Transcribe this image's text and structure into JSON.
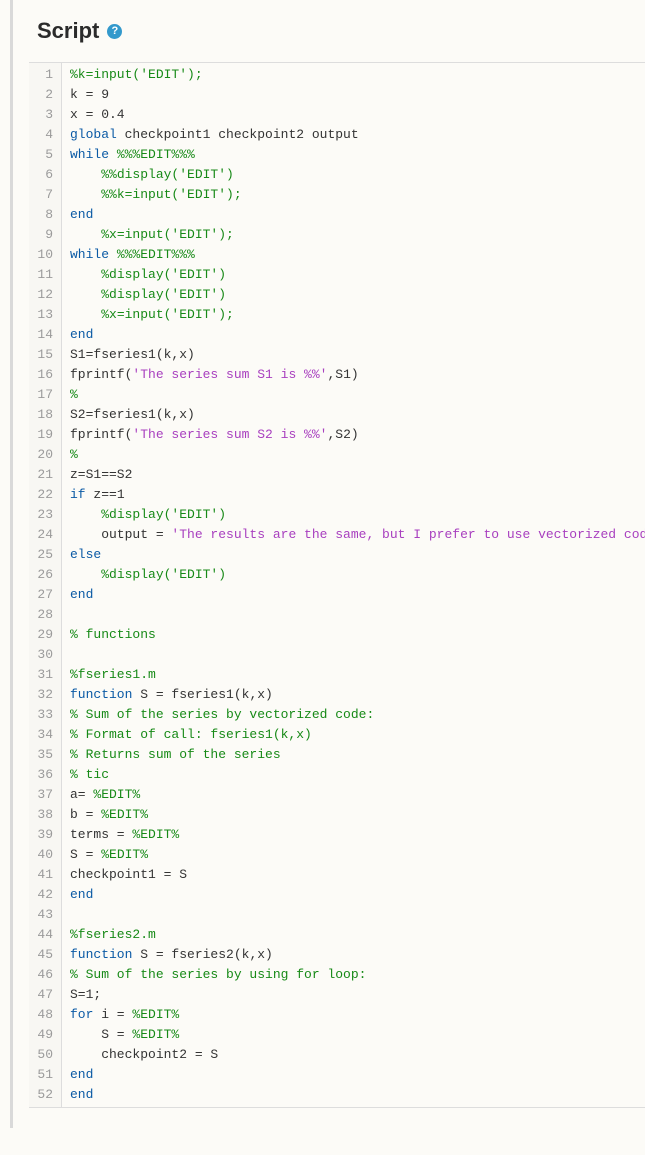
{
  "header": {
    "title": "Script",
    "help_symbol": "?"
  },
  "code_lines": [
    [
      {
        "cls": "c-comment",
        "text": "%k=input('EDIT');"
      }
    ],
    [
      {
        "cls": "c-plain",
        "text": "k = 9"
      }
    ],
    [
      {
        "cls": "c-plain",
        "text": "x = 0.4"
      }
    ],
    [
      {
        "cls": "c-keyword",
        "text": "global"
      },
      {
        "cls": "c-plain",
        "text": " checkpoint1 checkpoint2 output"
      }
    ],
    [
      {
        "cls": "c-keyword",
        "text": "while"
      },
      {
        "cls": "c-plain",
        "text": " "
      },
      {
        "cls": "c-comment",
        "text": "%%%EDIT%%%"
      }
    ],
    [
      {
        "cls": "c-plain",
        "text": "    "
      },
      {
        "cls": "c-comment",
        "text": "%%display('EDIT')"
      }
    ],
    [
      {
        "cls": "c-plain",
        "text": "    "
      },
      {
        "cls": "c-comment",
        "text": "%%k=input('EDIT');"
      }
    ],
    [
      {
        "cls": "c-keyword",
        "text": "end"
      }
    ],
    [
      {
        "cls": "c-plain",
        "text": "    "
      },
      {
        "cls": "c-comment",
        "text": "%x=input('EDIT');"
      }
    ],
    [
      {
        "cls": "c-keyword",
        "text": "while"
      },
      {
        "cls": "c-plain",
        "text": " "
      },
      {
        "cls": "c-comment",
        "text": "%%%EDIT%%%"
      }
    ],
    [
      {
        "cls": "c-plain",
        "text": "    "
      },
      {
        "cls": "c-comment",
        "text": "%display('EDIT')"
      }
    ],
    [
      {
        "cls": "c-plain",
        "text": "    "
      },
      {
        "cls": "c-comment",
        "text": "%display('EDIT')"
      }
    ],
    [
      {
        "cls": "c-plain",
        "text": "    "
      },
      {
        "cls": "c-comment",
        "text": "%x=input('EDIT');"
      }
    ],
    [
      {
        "cls": "c-keyword",
        "text": "end"
      }
    ],
    [
      {
        "cls": "c-plain",
        "text": "S1=fseries1(k,x)"
      }
    ],
    [
      {
        "cls": "c-plain",
        "text": "fprintf("
      },
      {
        "cls": "c-string",
        "text": "'The series sum S1 is %%'"
      },
      {
        "cls": "c-plain",
        "text": ",S1)"
      }
    ],
    [
      {
        "cls": "c-comment",
        "text": "%"
      }
    ],
    [
      {
        "cls": "c-plain",
        "text": "S2=fseries1(k,x)"
      }
    ],
    [
      {
        "cls": "c-plain",
        "text": "fprintf("
      },
      {
        "cls": "c-string",
        "text": "'The series sum S2 is %%'"
      },
      {
        "cls": "c-plain",
        "text": ",S2)"
      }
    ],
    [
      {
        "cls": "c-comment",
        "text": "%"
      }
    ],
    [
      {
        "cls": "c-plain",
        "text": "z=S1==S2"
      }
    ],
    [
      {
        "cls": "c-keyword",
        "text": "if"
      },
      {
        "cls": "c-plain",
        "text": " z==1"
      }
    ],
    [
      {
        "cls": "c-plain",
        "text": "    "
      },
      {
        "cls": "c-comment",
        "text": "%display('EDIT')"
      }
    ],
    [
      {
        "cls": "c-plain",
        "text": "    output = "
      },
      {
        "cls": "c-string",
        "text": "'The results are the same, but I prefer to use vectorized code'"
      }
    ],
    [
      {
        "cls": "c-keyword",
        "text": "else"
      }
    ],
    [
      {
        "cls": "c-plain",
        "text": "    "
      },
      {
        "cls": "c-comment",
        "text": "%display('EDIT')"
      }
    ],
    [
      {
        "cls": "c-keyword",
        "text": "end"
      }
    ],
    [
      {
        "cls": "c-plain",
        "text": ""
      }
    ],
    [
      {
        "cls": "c-comment",
        "text": "% functions"
      }
    ],
    [
      {
        "cls": "c-plain",
        "text": ""
      }
    ],
    [
      {
        "cls": "c-comment",
        "text": "%fseries1.m"
      }
    ],
    [
      {
        "cls": "c-keyword",
        "text": "function"
      },
      {
        "cls": "c-plain",
        "text": " S = fseries1(k,x)"
      }
    ],
    [
      {
        "cls": "c-comment",
        "text": "% Sum of the series by vectorized code:"
      }
    ],
    [
      {
        "cls": "c-comment",
        "text": "% Format of call: fseries1(k,x)"
      }
    ],
    [
      {
        "cls": "c-comment",
        "text": "% Returns sum of the series"
      }
    ],
    [
      {
        "cls": "c-comment",
        "text": "% tic"
      }
    ],
    [
      {
        "cls": "c-plain",
        "text": "a= "
      },
      {
        "cls": "c-comment",
        "text": "%EDIT%"
      }
    ],
    [
      {
        "cls": "c-plain",
        "text": "b = "
      },
      {
        "cls": "c-comment",
        "text": "%EDIT%"
      }
    ],
    [
      {
        "cls": "c-plain",
        "text": "terms = "
      },
      {
        "cls": "c-comment",
        "text": "%EDIT%"
      }
    ],
    [
      {
        "cls": "c-plain",
        "text": "S = "
      },
      {
        "cls": "c-comment",
        "text": "%EDIT%"
      }
    ],
    [
      {
        "cls": "c-plain",
        "text": "checkpoint1 = S"
      }
    ],
    [
      {
        "cls": "c-keyword",
        "text": "end"
      }
    ],
    [
      {
        "cls": "c-plain",
        "text": ""
      }
    ],
    [
      {
        "cls": "c-comment",
        "text": "%fseries2.m"
      }
    ],
    [
      {
        "cls": "c-keyword",
        "text": "function"
      },
      {
        "cls": "c-plain",
        "text": " S = fseries2(k,x)"
      }
    ],
    [
      {
        "cls": "c-comment",
        "text": "% Sum of the series by using for loop:"
      }
    ],
    [
      {
        "cls": "c-plain",
        "text": "S=1;"
      }
    ],
    [
      {
        "cls": "c-keyword",
        "text": "for"
      },
      {
        "cls": "c-plain",
        "text": " i = "
      },
      {
        "cls": "c-comment",
        "text": "%EDIT%"
      }
    ],
    [
      {
        "cls": "c-plain",
        "text": "    S = "
      },
      {
        "cls": "c-comment",
        "text": "%EDIT%"
      }
    ],
    [
      {
        "cls": "c-plain",
        "text": "    checkpoint2 = S"
      }
    ],
    [
      {
        "cls": "c-keyword",
        "text": "end"
      }
    ],
    [
      {
        "cls": "c-keyword",
        "text": "end"
      }
    ]
  ]
}
